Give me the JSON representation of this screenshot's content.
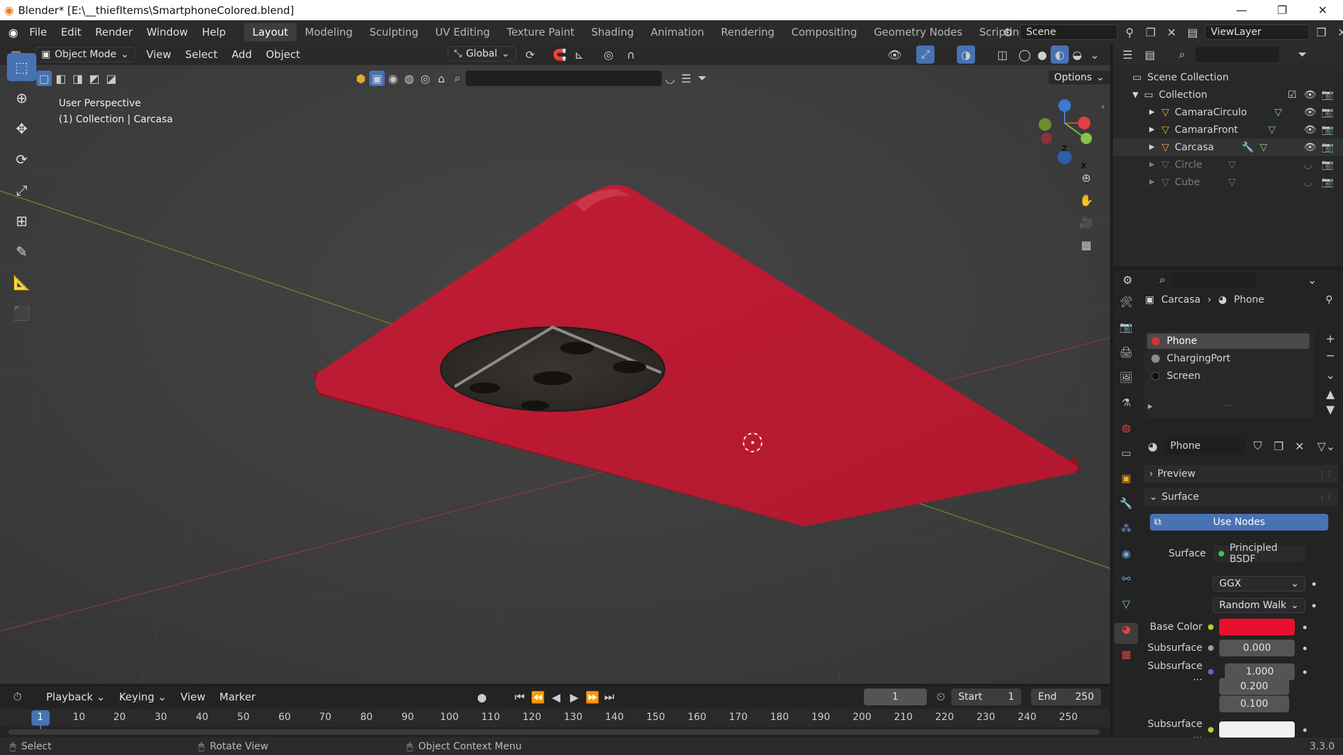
{
  "window": {
    "title": "Blender* [E:\\__thiefItems\\SmartphoneColored.blend]",
    "minimize": "—",
    "maximize": "❐",
    "close": "✕"
  },
  "menubar": {
    "menus": [
      "File",
      "Edit",
      "Render",
      "Window",
      "Help"
    ],
    "workspaces": [
      "Layout",
      "Modeling",
      "Sculpting",
      "UV Editing",
      "Texture Paint",
      "Shading",
      "Animation",
      "Rendering",
      "Compositing",
      "Geometry Nodes",
      "Scripting"
    ],
    "active_workspace": "Layout",
    "add_tab": "+",
    "scene_label": "Scene",
    "viewlayer_label": "ViewLayer"
  },
  "viewport": {
    "mode": "Object Mode",
    "menus": [
      "View",
      "Select",
      "Add",
      "Object"
    ],
    "transform_orientation": "Global",
    "options_label": "Options",
    "overlay_line1": "User Perspective",
    "overlay_line2": "(1) Collection | Carcasa",
    "gizmo": {
      "x": "X",
      "y": "Y",
      "z": "Z"
    }
  },
  "outliner": {
    "root": "Scene Collection",
    "collection": "Collection",
    "items": [
      {
        "name": "CamaraCirculo",
        "dim": false
      },
      {
        "name": "CamaraFront",
        "dim": false
      },
      {
        "name": "Carcasa",
        "dim": false
      },
      {
        "name": "Circle",
        "dim": true
      },
      {
        "name": "Cube",
        "dim": true
      }
    ]
  },
  "properties": {
    "breadcrumb_object": "Carcasa",
    "breadcrumb_material": "Phone",
    "materials": [
      {
        "name": "Phone",
        "color": "#d2323c"
      },
      {
        "name": "ChargingPort",
        "color": "#8a8a8a"
      },
      {
        "name": "Screen",
        "color": "#111111"
      }
    ],
    "active_material": "Phone",
    "preview_label": "Preview",
    "surface_label": "Surface",
    "use_nodes_label": "Use Nodes",
    "surface_field_label": "Surface",
    "surface_shader": "Principled BSDF",
    "distribution": "GGX",
    "subsurface_method": "Random Walk",
    "base_color_label": "Base Color",
    "base_color": "#e8102d",
    "subsurface_label": "Subsurface",
    "subsurface_value": "0.000",
    "subsurface_radius_label": "Subsurface ...",
    "subsurface_radius": [
      "1.000",
      "0.200",
      "0.100"
    ],
    "subsurface_color_label": "Subsurface ...",
    "subsurface_color": "#f0f0f0"
  },
  "timeline": {
    "menus": [
      "Playback",
      "Keying",
      "View",
      "Marker"
    ],
    "current_frame": "1",
    "start_label": "Start",
    "start": "1",
    "end_label": "End",
    "end": "250",
    "ruler": [
      "1",
      "10",
      "20",
      "30",
      "40",
      "50",
      "60",
      "70",
      "80",
      "90",
      "100",
      "110",
      "120",
      "130",
      "140",
      "150",
      "160",
      "170",
      "180",
      "190",
      "200",
      "210",
      "220",
      "230",
      "240",
      "250"
    ]
  },
  "statusbar": {
    "select": "Select",
    "rotate": "Rotate View",
    "context": "Object Context Menu",
    "version": "3.3.0"
  },
  "colors": {
    "accent": "#4772b3",
    "phone_red": "#c8213a",
    "active_frame": "#4772b3"
  }
}
